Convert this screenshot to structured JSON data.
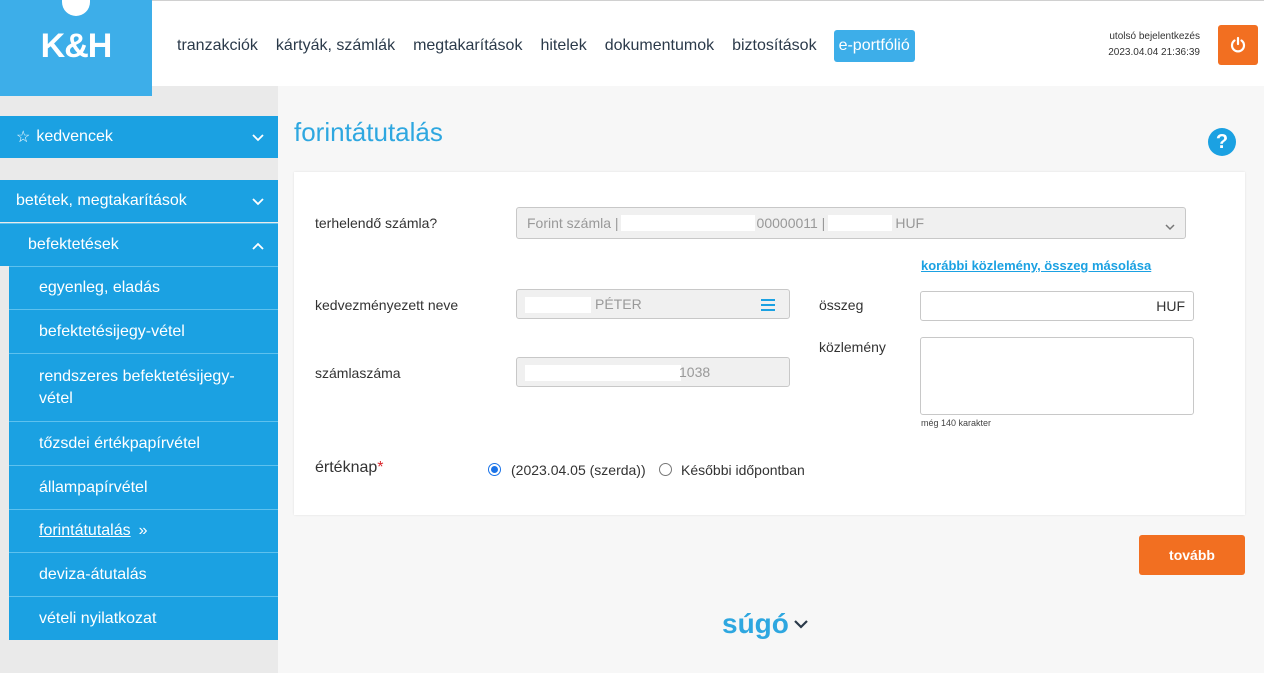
{
  "logo": {
    "text": "K&H"
  },
  "nav": {
    "items": [
      "tranzakciók",
      "kártyák, számlák",
      "megtakarítások",
      "hitelek",
      "dokumentumok",
      "biztosítások"
    ],
    "active": "e-portfólió"
  },
  "header": {
    "last_login_label": "utolsó bejelentkezés",
    "last_login_value": "2023.04.04 21:36:39"
  },
  "sidebar": {
    "favorites": "kedvencek",
    "savings": "betétek, megtakarítások",
    "investments": "befektetések",
    "sub_items": [
      "egyenleg, eladás",
      "befektetésijegy-vétel",
      "rendszeres befektetésijegy-vétel",
      "tőzsdei értékpapírvétel",
      "állampapírvétel",
      "forintátutalás",
      "deviza-átutalás",
      "vételi nyilatkozat"
    ]
  },
  "main": {
    "title": "forintátutalás",
    "help": "?",
    "form": {
      "account_label": "terhelendő számla?",
      "account_value_prefix": "Forint számla |",
      "account_value_mid": "00000011 |",
      "account_value_currency": "HUF",
      "copy_link": "korábbi közlemény, összeg másolása",
      "beneficiary_label": "kedvezményezett neve",
      "beneficiary_value": "PÉTER",
      "amount_label": "összeg",
      "amount_currency": "HUF",
      "account_number_label": "számlaszáma",
      "account_number_value": "1038",
      "note_label": "közlemény",
      "note_hint": "még 140 karakter",
      "date_label": "értéknap",
      "date_required": "*",
      "date_option_1": "(2023.04.05 (szerda))",
      "date_option_2": "Későbbi időpontban"
    },
    "next_button": "tovább",
    "help_section": "súgó"
  }
}
